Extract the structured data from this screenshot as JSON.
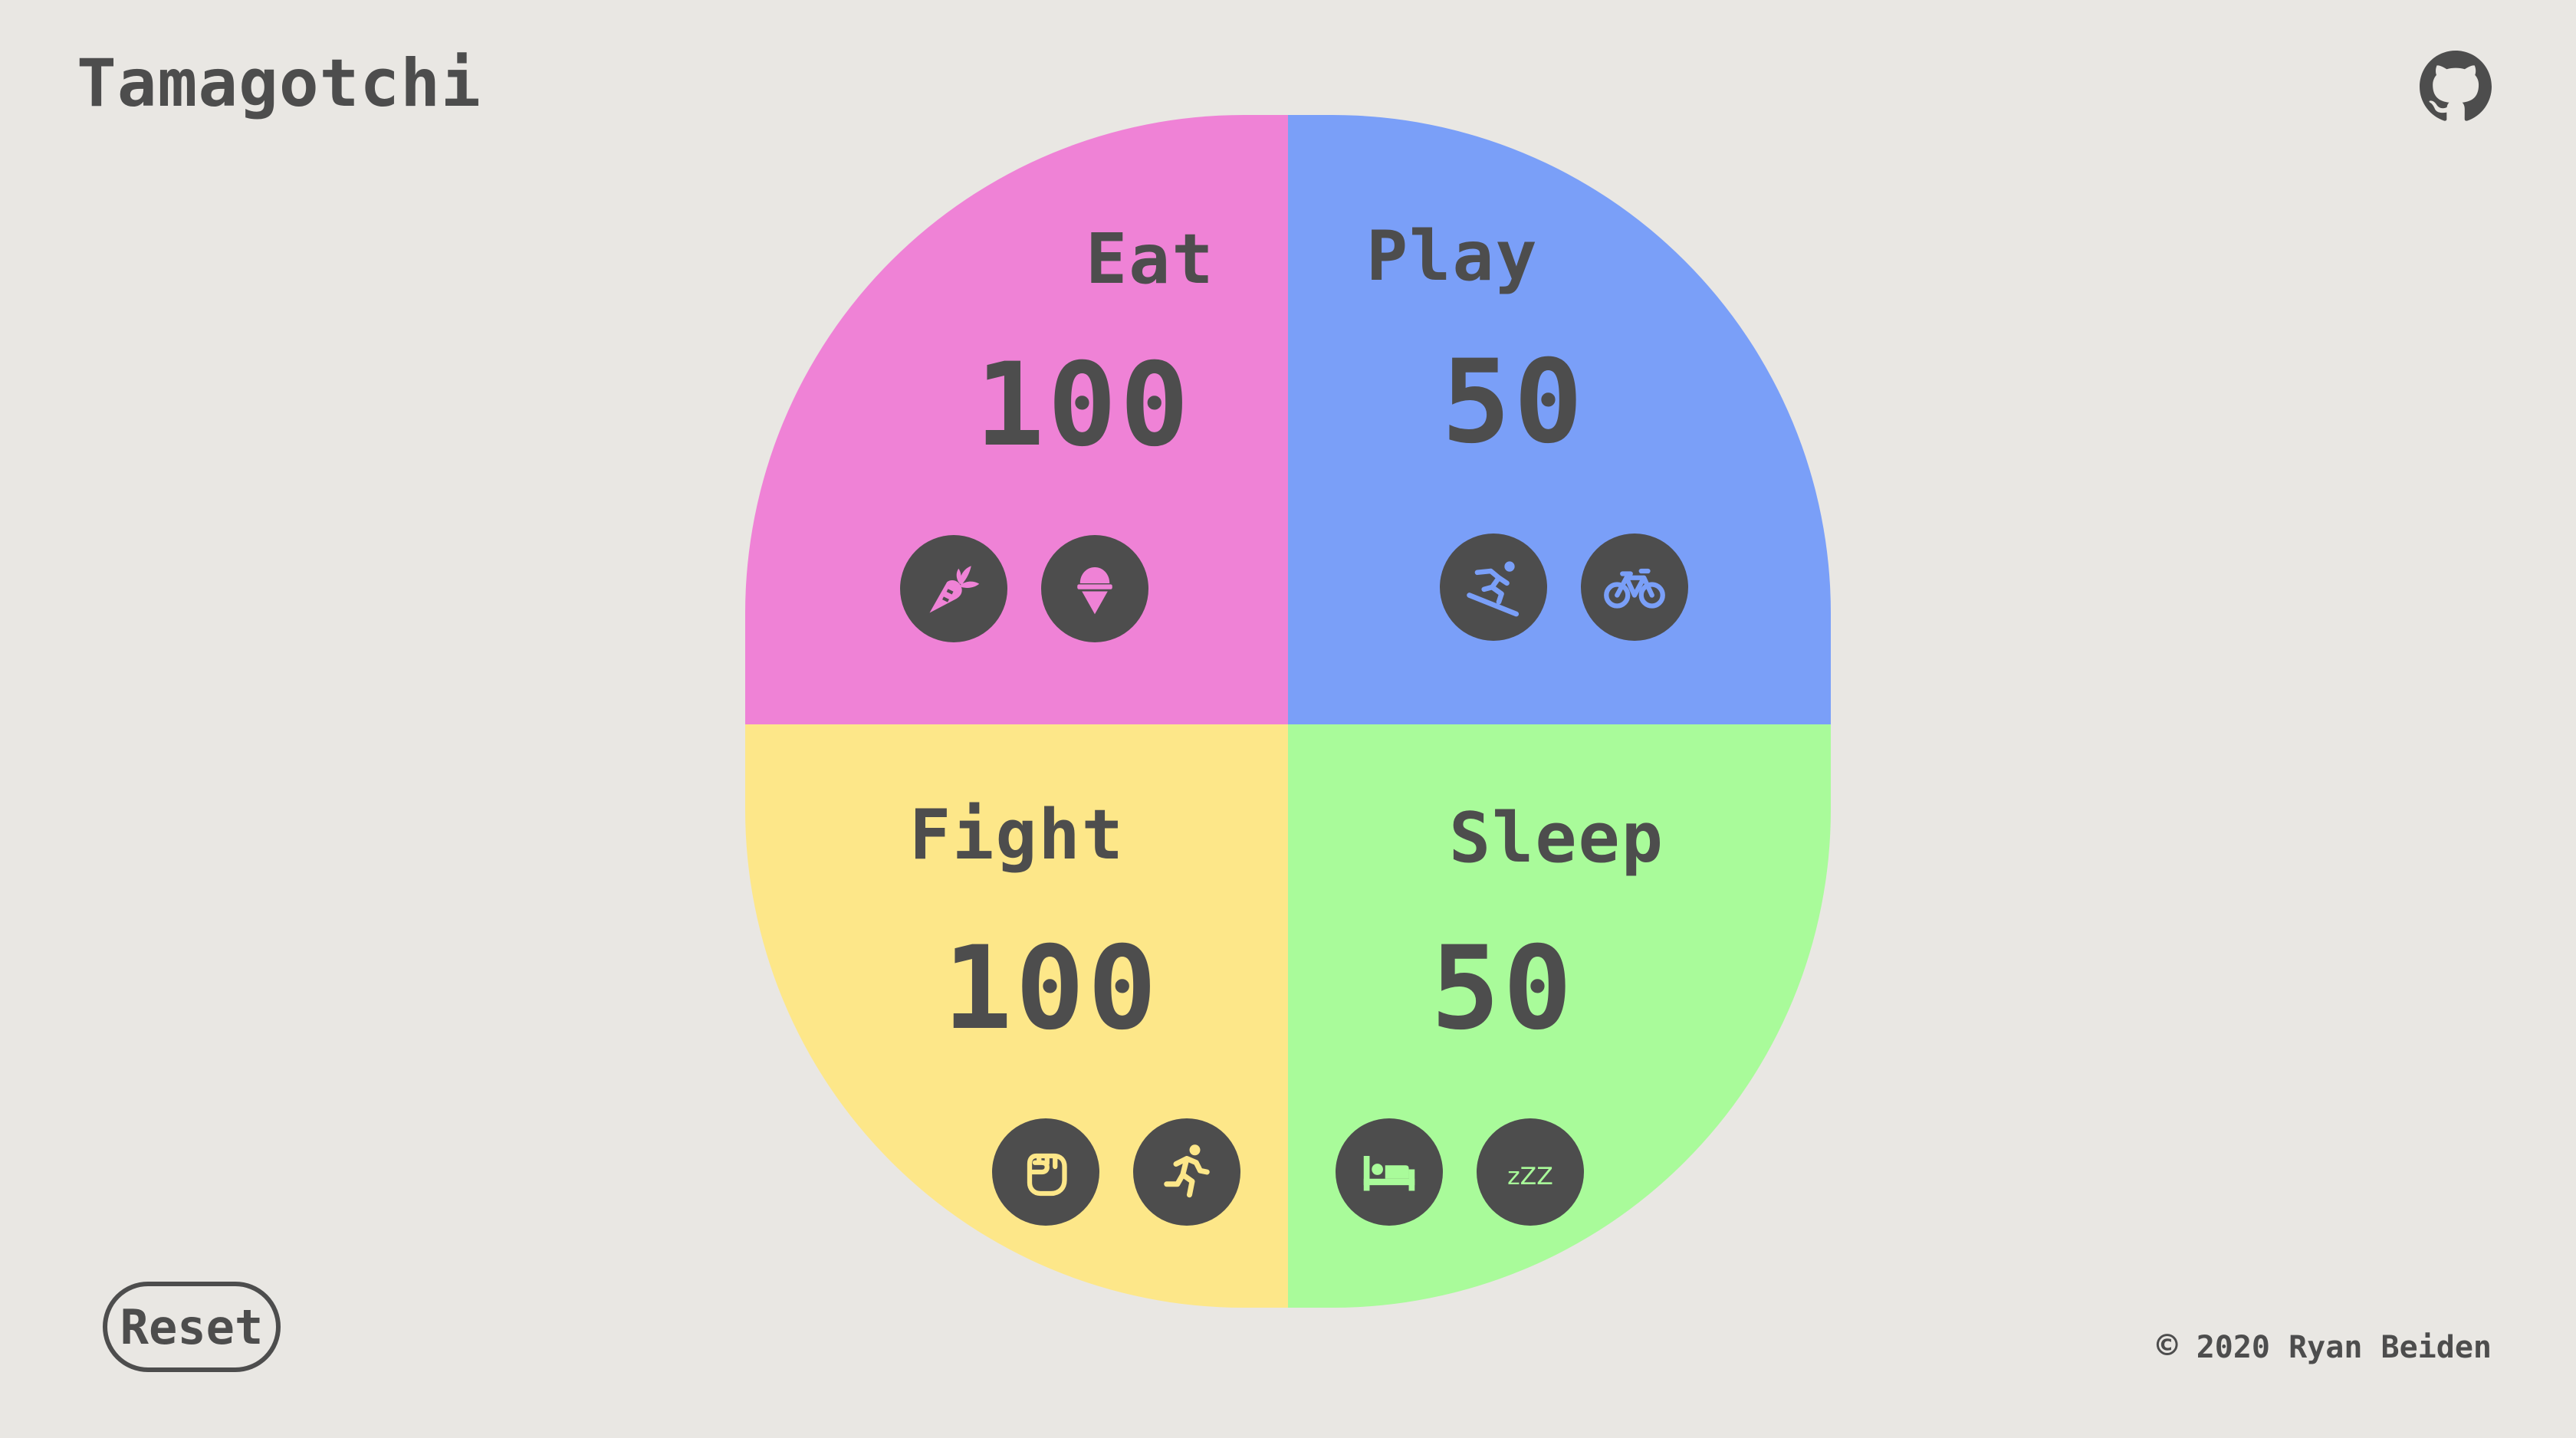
{
  "app": {
    "title": "Tamagotchi",
    "github_icon": "github-icon"
  },
  "colors": {
    "background": "#e9e7e3",
    "ink": "#4d4d4d",
    "eat": "#ef82d6",
    "play": "#7a9ff8",
    "fight": "#fde789",
    "sleep": "#a9fb9a"
  },
  "quadrants": {
    "eat": {
      "label": "Eat",
      "value": "100",
      "actions": [
        {
          "icon": "carrot-icon"
        },
        {
          "icon": "ice-cream-icon"
        }
      ]
    },
    "play": {
      "label": "Play",
      "value": "50",
      "actions": [
        {
          "icon": "skiing-icon"
        },
        {
          "icon": "bicycle-icon"
        }
      ]
    },
    "fight": {
      "label": "Fight",
      "value": "100",
      "actions": [
        {
          "icon": "fist-icon"
        },
        {
          "icon": "running-icon"
        }
      ]
    },
    "sleep": {
      "label": "Sleep",
      "value": "50",
      "actions": [
        {
          "icon": "bed-icon"
        },
        {
          "icon": "zzz-icon",
          "text": "zZZ"
        }
      ]
    }
  },
  "footer": {
    "reset_label": "Reset",
    "copyright_symbol": "©",
    "copyright_text": "2020 Ryan Beiden"
  }
}
